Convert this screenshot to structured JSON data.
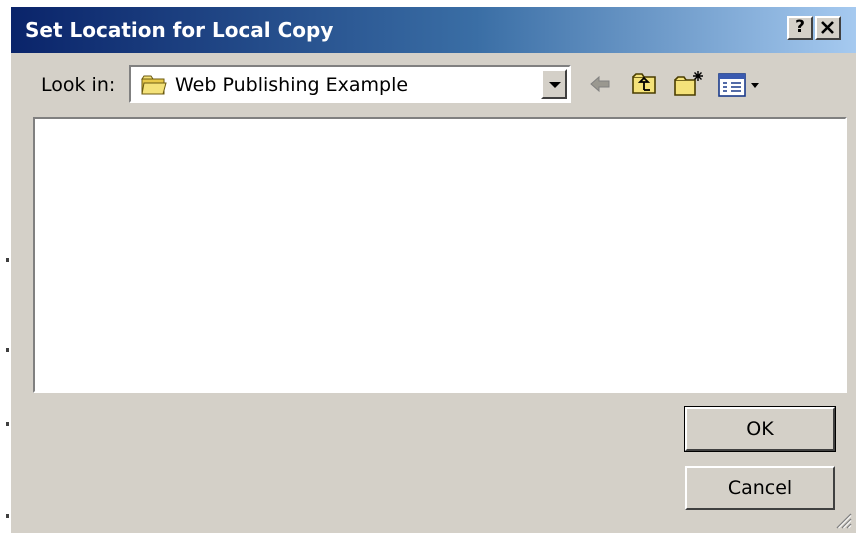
{
  "window": {
    "title": "Set Location for Local Copy",
    "help_label": "?",
    "close_label": "✕"
  },
  "lookin": {
    "label": "Look in:",
    "value": "Web Publishing Example"
  },
  "toolbar": {
    "icons": [
      "back-arrow-icon",
      "up-one-level-icon",
      "create-new-folder-icon",
      "view-menu-icon"
    ]
  },
  "buttons": {
    "ok_label": "OK",
    "cancel_label": "Cancel"
  },
  "colors": {
    "dialog_face": "#d4d0c8",
    "titlebar_start": "#0a246a",
    "titlebar_end": "#a6caf0",
    "folder_yellow": "#f4e27a"
  }
}
